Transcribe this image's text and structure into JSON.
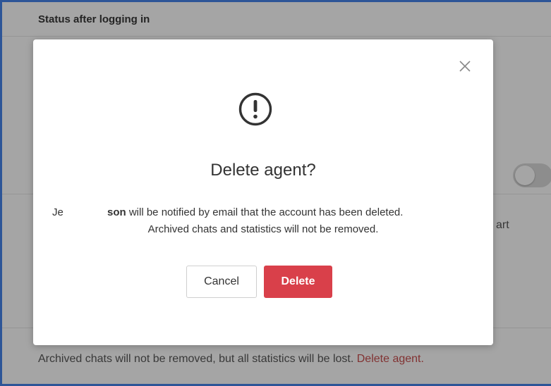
{
  "background": {
    "section_title": "Status after logging in",
    "side_text_fragment": "art",
    "footer_text": "Archived chats will not be removed, but all statistics will be lost.",
    "footer_link": "Delete agent.",
    "toggle_state": "off"
  },
  "dialog": {
    "close_icon": "close-icon",
    "alert_icon": "exclamation-circle-icon",
    "title": "Delete agent?",
    "message": {
      "name_start": "Je",
      "name_end": "son",
      "line1_rest": " will be notified by email that the account has been deleted.",
      "line2": "Archived chats and statistics will not be removed."
    },
    "cancel_label": "Cancel",
    "delete_label": "Delete"
  },
  "colors": {
    "frame_border": "#2d5597",
    "danger": "#d9404a",
    "link_danger": "#c23a3a"
  }
}
